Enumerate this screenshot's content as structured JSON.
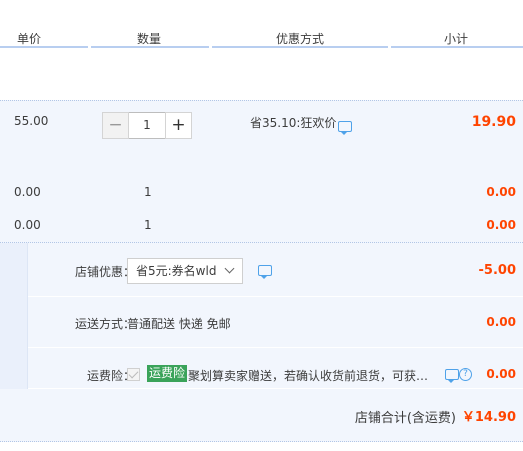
{
  "header": {
    "col_price": "单价",
    "col_qty": "数量",
    "col_promo": "优惠方式",
    "col_subtotal": "小计"
  },
  "item": {
    "price": "55.00",
    "qty_minus": "−",
    "qty_value": "1",
    "qty_plus": "+",
    "promo": "省35.10:狂欢价",
    "promo_icon": "chat-icon",
    "subtotal": "19.90"
  },
  "sub_items": [
    {
      "price": "0.00",
      "qty": "1",
      "subtotal": "0.00"
    },
    {
      "price": "0.00",
      "qty": "1",
      "subtotal": "0.00"
    }
  ],
  "shop": {
    "discount_label": "店铺优惠：",
    "discount_selected": "省5元:券名wld",
    "discount_value": "-5.00",
    "shipping_label": "运送方式：",
    "shipping_value": "普通配送 快递 免邮",
    "shipping_cost": "0.00",
    "insurance_label": "运费险：",
    "insurance_badge": "运费险",
    "insurance_desc": "聚划算卖家赠送，若确认收货前退货，可获…",
    "insurance_help": "?",
    "insurance_cost": "0.00",
    "total_label": "店铺合计(含运费)",
    "total_value": "￥14.90"
  },
  "colors": {
    "price_red": "#ff4400",
    "accent_blue": "#4fa2e9",
    "badge_green": "#3aa35a",
    "row_bg": "#f2f6fd"
  }
}
